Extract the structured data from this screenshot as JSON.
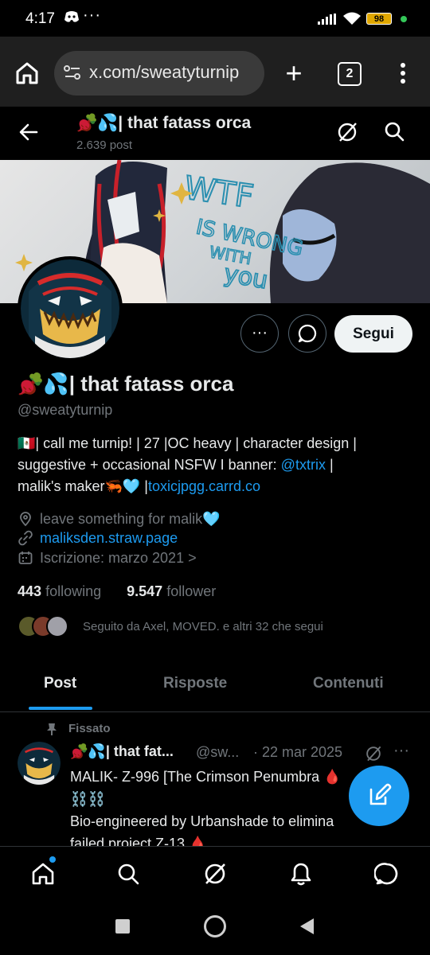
{
  "status_bar": {
    "time": "4:17",
    "dots": "···",
    "battery": "98"
  },
  "browser": {
    "url": "x.com/sweatyturnip",
    "tab_count": "2",
    "new_tab": "+"
  },
  "header": {
    "title": "🫜💦| that fatass orca",
    "posts_count": "2.639 post"
  },
  "profile": {
    "display_name": "🫜💦| that fatass orca",
    "handle": "@sweatyturnip",
    "bio_line1": "🇲🇽| call me turnip! | 27 |OC heavy | character design |",
    "bio_line2": "suggestive + occasional NSFW I banner: ",
    "bio_mention": "@txtrix",
    "bio_line2_end": " |",
    "bio_line3": "malik's maker🦐🩵 |",
    "bio_link": "toxicjpgg.carrd.co",
    "location": "leave something for malik🩵",
    "website": "maliksden.straw.page",
    "joined": "Iscrizione: marzo 2021",
    "joined_chevron": ">",
    "following_count": "443",
    "following_label": "following",
    "follower_count": "9.547",
    "follower_label": "follower",
    "followed_by": "Seguito da Axel, MOVED. e altri 32 che segui"
  },
  "actions": {
    "more": "···",
    "follow": "Segui"
  },
  "tabs": [
    {
      "label": "Post"
    },
    {
      "label": "Risposte"
    },
    {
      "label": "Contenuti"
    }
  ],
  "tweet": {
    "pinned_label": "Fissato",
    "name": "🫜💦| that fat...",
    "handle": "@sw...",
    "date": "· 22 mar 2025",
    "more": "···",
    "line1": "MALIK- Z-996 [The Crimson Penumbra 🩸",
    "line2": "⛓️⛓️",
    "line3": "Bio-engineered by Urbanshade to elimina",
    "line4": "failed project Z-13 🩸"
  },
  "colors": {
    "accent": "#1d9bf0",
    "background": "#000000",
    "muted": "#71767b",
    "text": "#e7e9ea"
  }
}
